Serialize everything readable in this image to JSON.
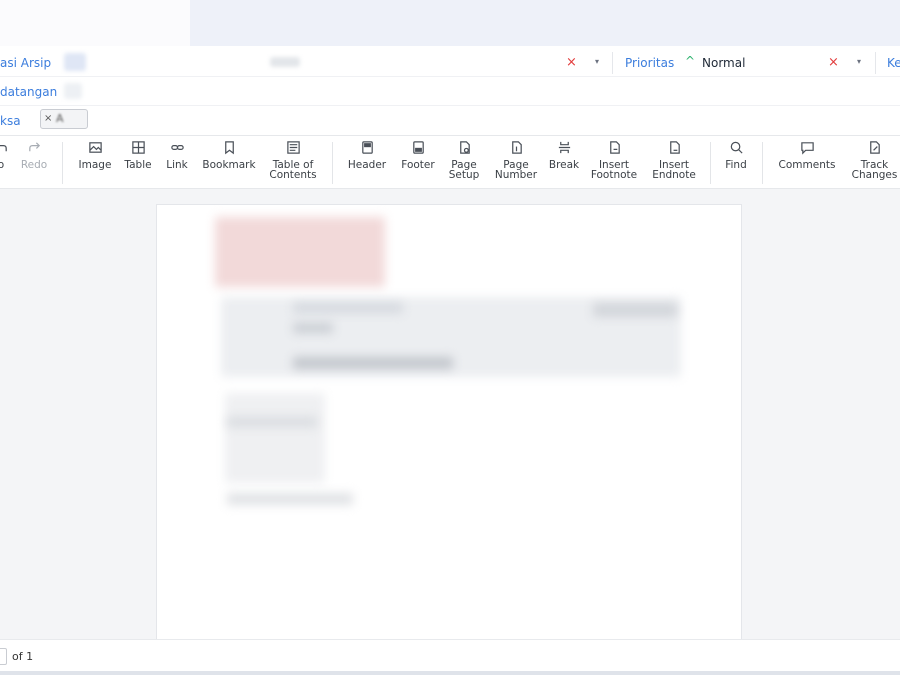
{
  "form": {
    "row1_label": "asi Arsip",
    "row2_label": "datangan",
    "row3_label": "ksa",
    "clear_symbol": "×",
    "caret_symbol": "▾",
    "priority": {
      "label": "Prioritas",
      "icon": "chevron-up-icon",
      "icon_glyph": "^",
      "value": "Normal"
    },
    "next_label": "Ke",
    "tag_chip": {
      "remove": "×",
      "value": "A"
    }
  },
  "ribbon": {
    "buttons": [
      {
        "id": "undo",
        "label": "o",
        "icon": "undo-icon"
      },
      {
        "id": "redo",
        "label": "Redo",
        "icon": "redo-icon"
      },
      {
        "id": "image",
        "label": "Image",
        "icon": "image-icon"
      },
      {
        "id": "table",
        "label": "Table",
        "icon": "table-icon"
      },
      {
        "id": "link",
        "label": "Link",
        "icon": "link-icon"
      },
      {
        "id": "bookmark",
        "label": "Bookmark",
        "icon": "bookmark-icon"
      },
      {
        "id": "toc",
        "label": "Table of\nContents",
        "icon": "toc-icon"
      },
      {
        "id": "header",
        "label": "Header",
        "icon": "header-icon"
      },
      {
        "id": "footer",
        "label": "Footer",
        "icon": "footer-icon"
      },
      {
        "id": "page-setup",
        "label": "Page\nSetup",
        "icon": "page-setup-icon"
      },
      {
        "id": "page-number",
        "label": "Page\nNumber",
        "icon": "page-number-icon"
      },
      {
        "id": "break",
        "label": "Break",
        "icon": "break-icon"
      },
      {
        "id": "insert-footnote",
        "label": "Insert\nFootnote",
        "icon": "footnote-icon"
      },
      {
        "id": "insert-endnote",
        "label": "Insert\nEndnote",
        "icon": "endnote-icon"
      },
      {
        "id": "find",
        "label": "Find",
        "icon": "search-icon"
      },
      {
        "id": "comments",
        "label": "Comments",
        "icon": "comment-icon"
      },
      {
        "id": "track-changes",
        "label": "Track\nChanges",
        "icon": "track-changes-icon"
      }
    ]
  },
  "status": {
    "page_of": "of 1"
  },
  "colors": {
    "accent": "#3b7ddd",
    "danger": "#e23b3b",
    "priority_normal": "#2fb36f"
  }
}
